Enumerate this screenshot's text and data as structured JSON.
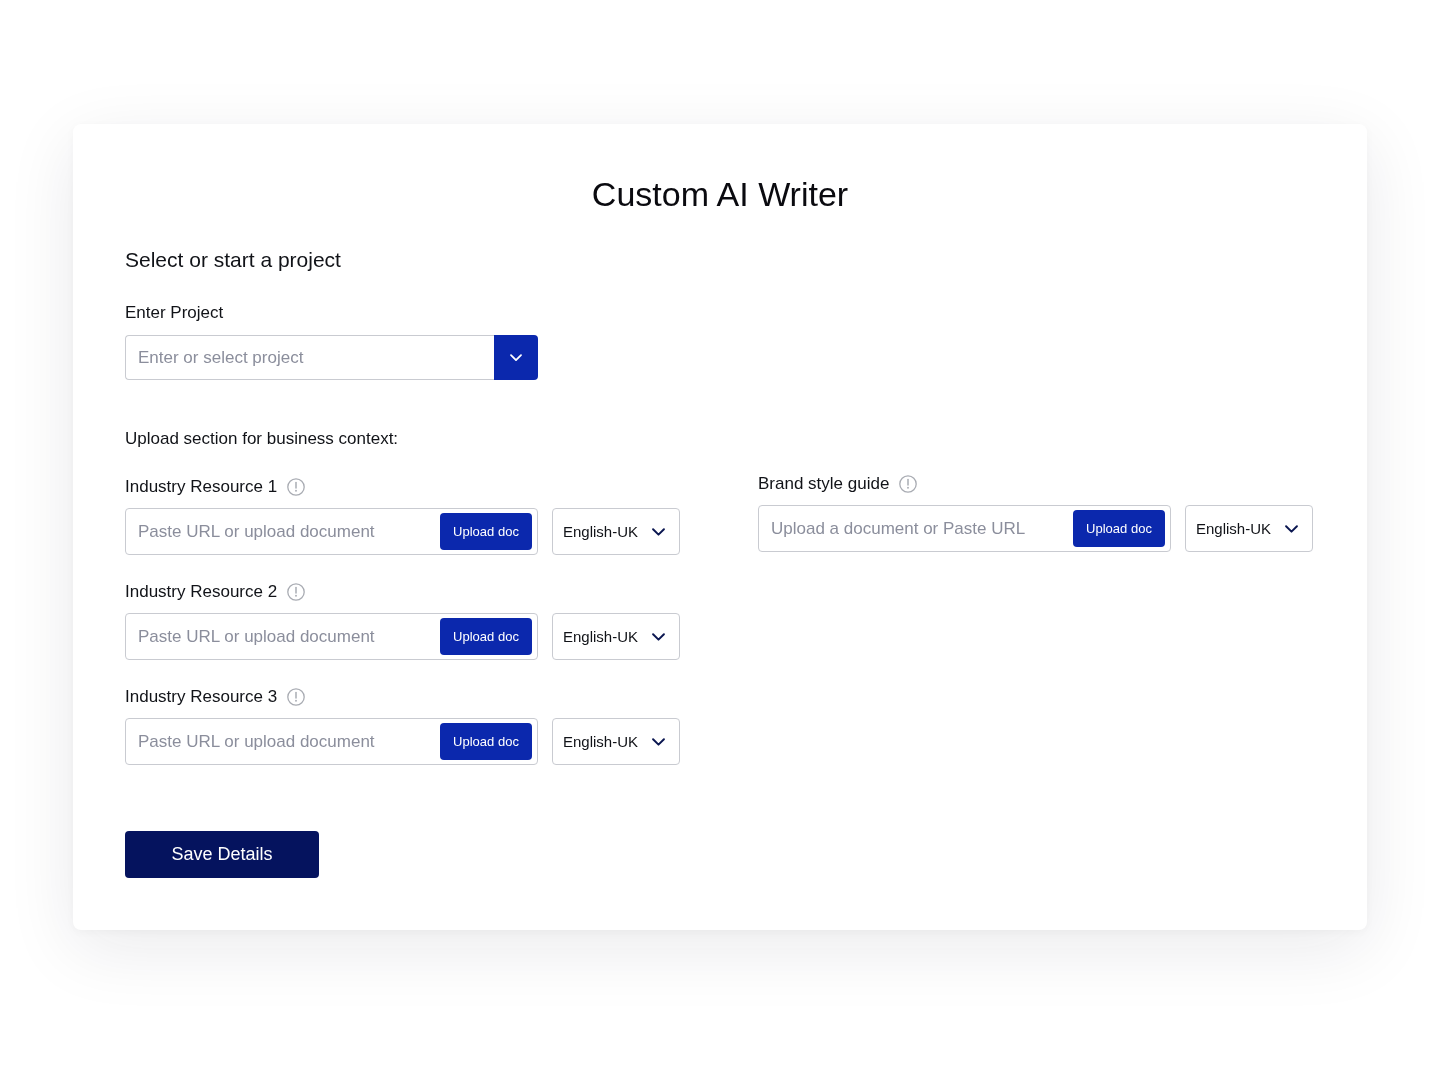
{
  "title": "Custom AI Writer",
  "section_heading": "Select or start a project",
  "project": {
    "label": "Enter Project",
    "placeholder": "Enter or select project"
  },
  "upload_section": {
    "heading": "Upload section for business context:"
  },
  "industry_resources": [
    {
      "label": "Industry Resource 1",
      "placeholder": "Paste URL or upload document",
      "button": "Upload doc",
      "language": "English-UK"
    },
    {
      "label": "Industry Resource 2",
      "placeholder": "Paste URL or upload document",
      "button": "Upload doc",
      "language": "English-UK"
    },
    {
      "label": "Industry Resource 3",
      "placeholder": "Paste URL or upload document",
      "button": "Upload doc",
      "language": "English-UK"
    }
  ],
  "brand_style_guide": {
    "label": "Brand style guide",
    "placeholder": "Upload a document or Paste URL",
    "button": "Upload doc",
    "language": "English-UK"
  },
  "save_button": "Save Details"
}
